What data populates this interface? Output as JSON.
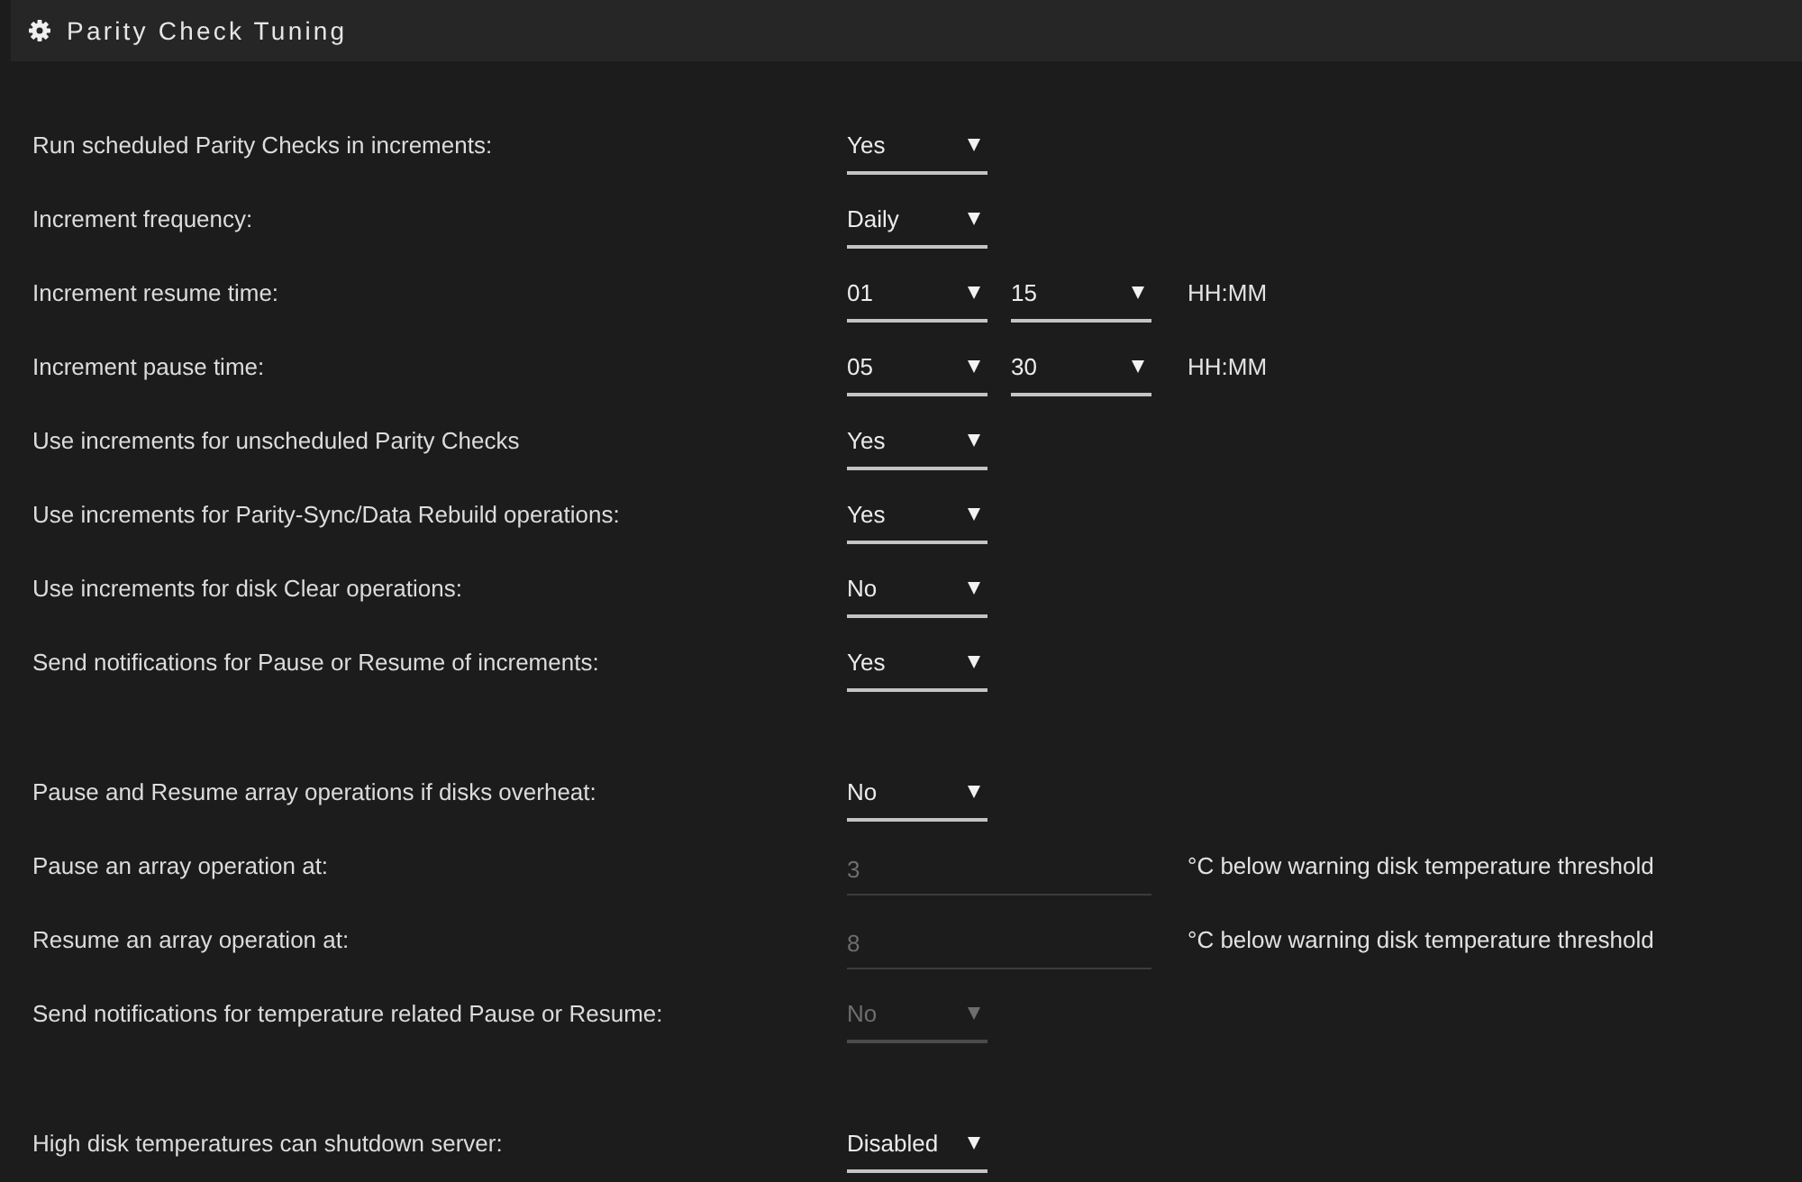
{
  "panel": {
    "title": "Parity Check Tuning"
  },
  "groups": [
    {
      "rows": [
        {
          "label": "Run scheduled Parity Checks in increments:",
          "controls": [
            {
              "kind": "select",
              "value": "Yes",
              "disabled": false
            }
          ]
        },
        {
          "label": "Increment frequency:",
          "controls": [
            {
              "kind": "select",
              "value": "Daily",
              "disabled": false
            }
          ]
        },
        {
          "label": "Increment resume time:",
          "controls": [
            {
              "kind": "select",
              "value": "01",
              "disabled": false
            },
            {
              "kind": "select",
              "value": "15",
              "disabled": false
            }
          ],
          "suffix": "HH:MM"
        },
        {
          "label": "Increment pause time:",
          "controls": [
            {
              "kind": "select",
              "value": "05",
              "disabled": false
            },
            {
              "kind": "select",
              "value": "30",
              "disabled": false
            }
          ],
          "suffix": "HH:MM"
        },
        {
          "label": "Use increments for unscheduled Parity Checks",
          "controls": [
            {
              "kind": "select",
              "value": "Yes",
              "disabled": false
            }
          ]
        },
        {
          "label": "Use increments for Parity-Sync/Data Rebuild operations:",
          "controls": [
            {
              "kind": "select",
              "value": "Yes",
              "disabled": false
            }
          ]
        },
        {
          "label": "Use increments for disk Clear operations:",
          "controls": [
            {
              "kind": "select",
              "value": "No",
              "disabled": false
            }
          ]
        },
        {
          "label": "Send notifications for Pause or Resume of increments:",
          "controls": [
            {
              "kind": "select",
              "value": "Yes",
              "disabled": false
            }
          ]
        }
      ]
    },
    {
      "rows": [
        {
          "label": "Pause and Resume array operations if disks overheat:",
          "controls": [
            {
              "kind": "select",
              "value": "No",
              "disabled": false
            }
          ]
        },
        {
          "label": "Pause an array operation at:",
          "controls": [
            {
              "kind": "input",
              "value": "3",
              "disabled": true
            }
          ],
          "suffix": "°C below warning disk temperature threshold"
        },
        {
          "label": "Resume an array operation at:",
          "controls": [
            {
              "kind": "input",
              "value": "8",
              "disabled": true
            }
          ],
          "suffix": "°C below warning disk temperature threshold"
        },
        {
          "label": "Send notifications for temperature related Pause or Resume:",
          "controls": [
            {
              "kind": "select",
              "value": "No",
              "disabled": true
            }
          ]
        }
      ]
    },
    {
      "rows": [
        {
          "label": "High disk temperatures can shutdown server:",
          "controls": [
            {
              "kind": "select",
              "value": "Disabled",
              "disabled": false
            }
          ]
        }
      ]
    }
  ]
}
